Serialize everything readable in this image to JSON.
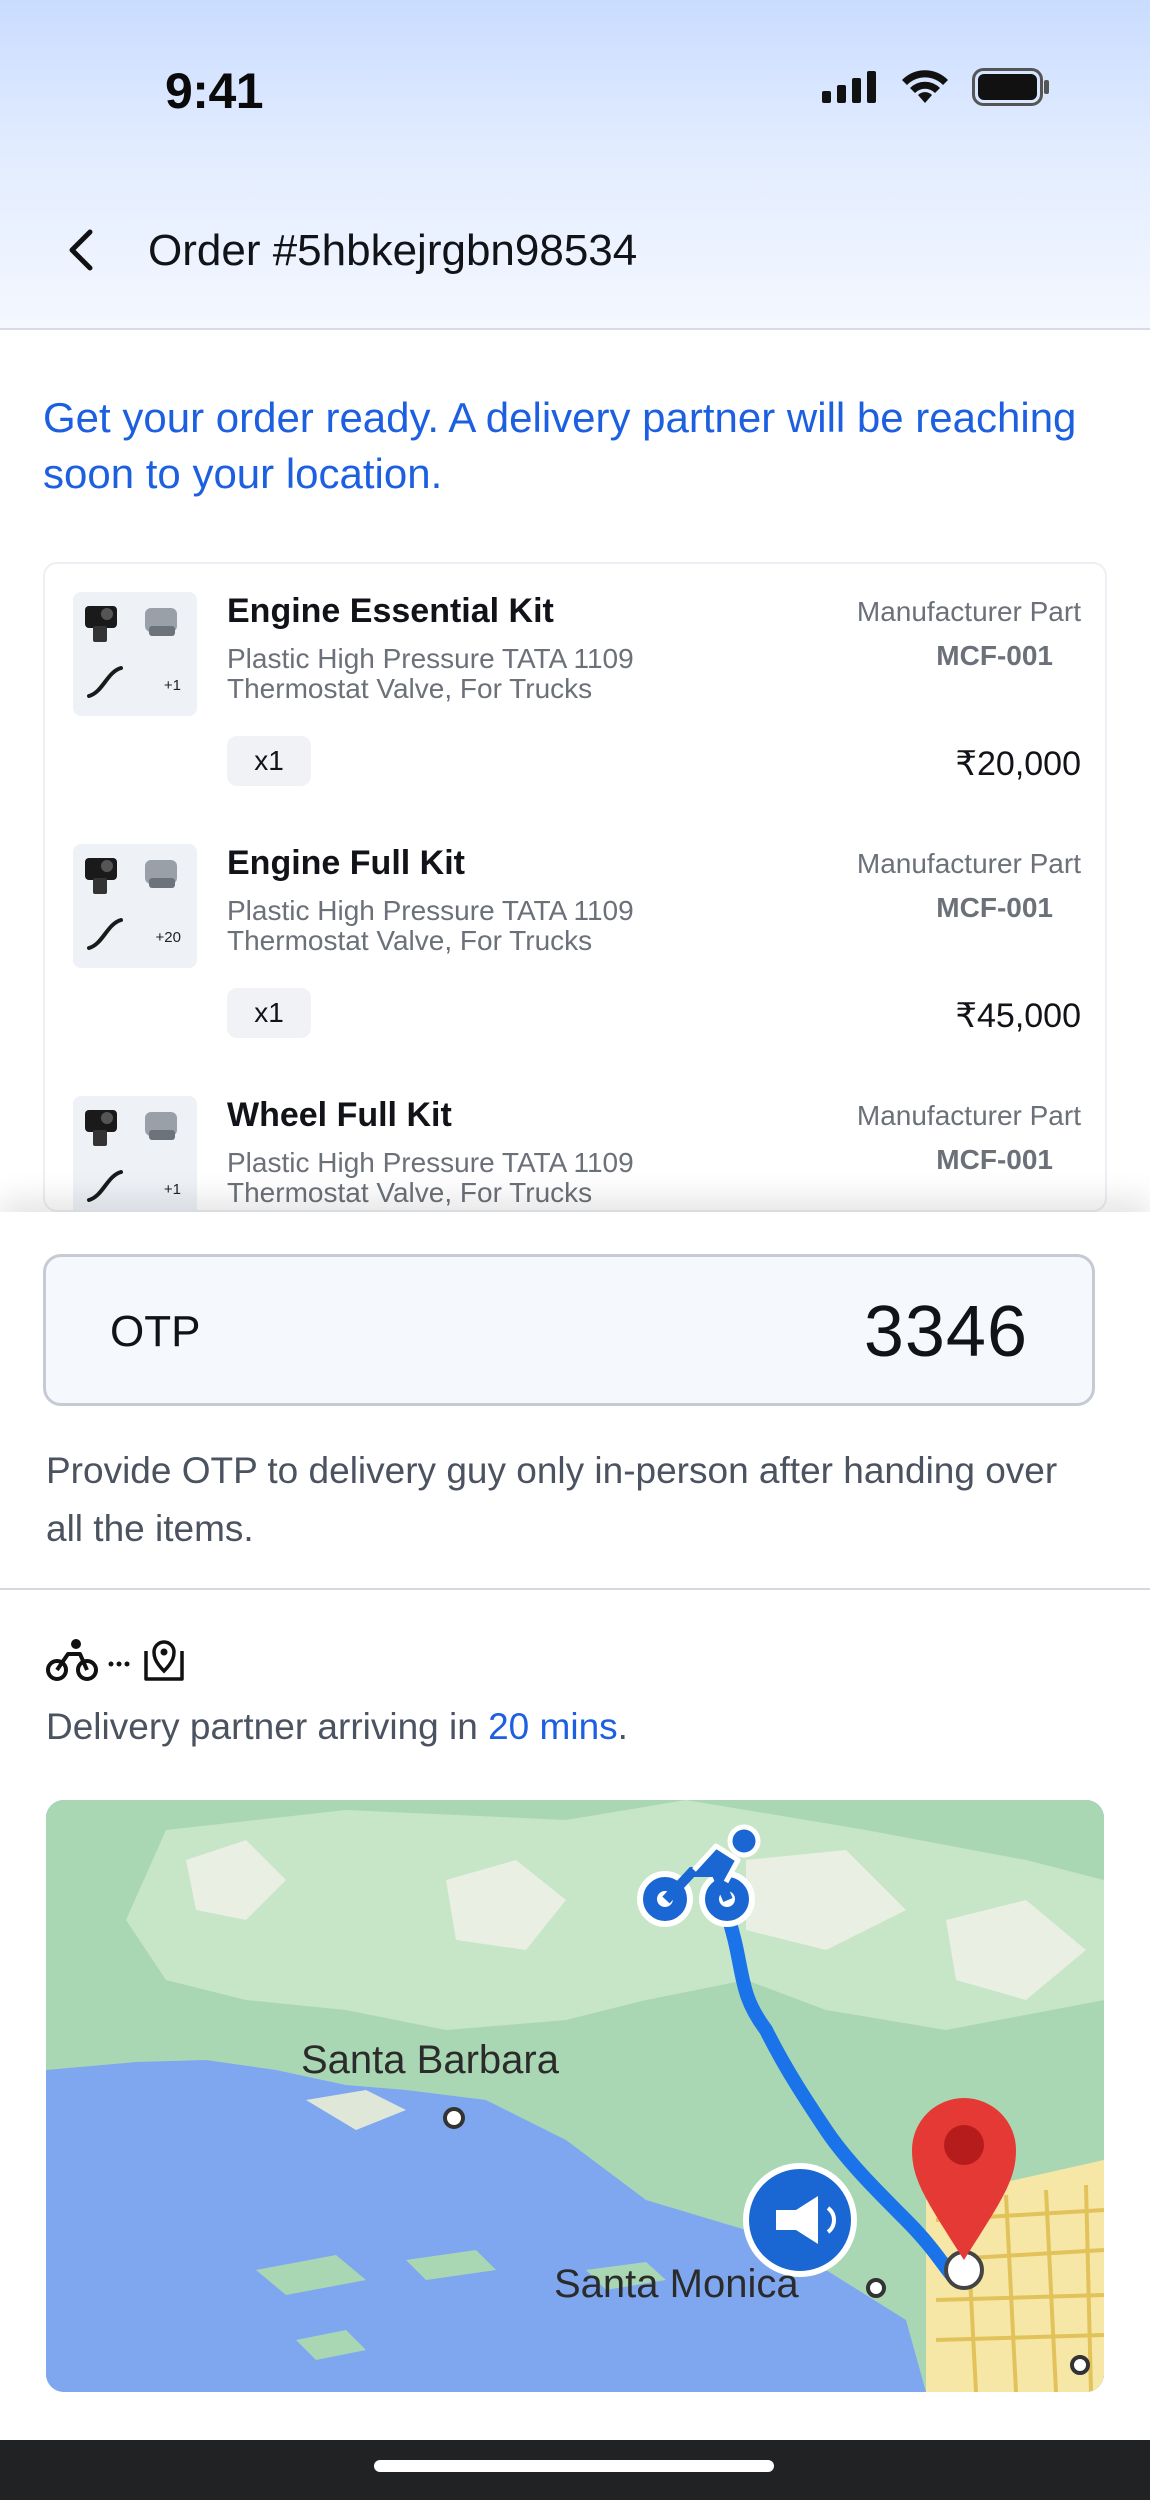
{
  "status_bar": {
    "time": "9:41"
  },
  "header": {
    "title": "Order #5hbkejrgbn98534"
  },
  "headline": "Get your order ready. A delivery partner will be reaching soon to your location.",
  "items": [
    {
      "name": "Engine Essential Kit",
      "description": "Plastic High Pressure TATA 1109 Thermostat Valve, For Trucks",
      "manufacturer_label": "Manufacturer Part",
      "manufacturer_code": "MCF-001",
      "quantity": "x1",
      "price": "₹20,000",
      "more_count": "+1"
    },
    {
      "name": "Engine Full Kit",
      "description": "Plastic High Pressure TATA 1109 Thermostat Valve, For Trucks",
      "manufacturer_label": "Manufacturer Part",
      "manufacturer_code": "MCF-001",
      "quantity": "x1",
      "price": "₹45,000",
      "more_count": "+20"
    },
    {
      "name": "Wheel Full Kit",
      "description": "Plastic High Pressure TATA 1109 Thermostat Valve, For Trucks",
      "manufacturer_label": "Manufacturer Part",
      "manufacturer_code": "MCF-001",
      "quantity": "",
      "price": "",
      "more_count": "+1"
    }
  ],
  "otp": {
    "label": "OTP",
    "value": "3346",
    "note": "Provide OTP to delivery guy only in-person after handing over all the items."
  },
  "eta": {
    "prefix": "Delivery partner arriving in ",
    "highlight": "20 mins",
    "suffix": "."
  },
  "map": {
    "labels": [
      "Santa Barbara",
      "Santa Monica"
    ]
  },
  "colors": {
    "accent": "#1c5fe0",
    "route": "#1a73e8",
    "pin": "#e53935",
    "header_gradient_top": "#c9dcff"
  },
  "icons": {
    "back": "chevron-left-icon",
    "bike": "bicycle-icon",
    "destination": "map-pin-icon",
    "announce": "megaphone-icon"
  }
}
